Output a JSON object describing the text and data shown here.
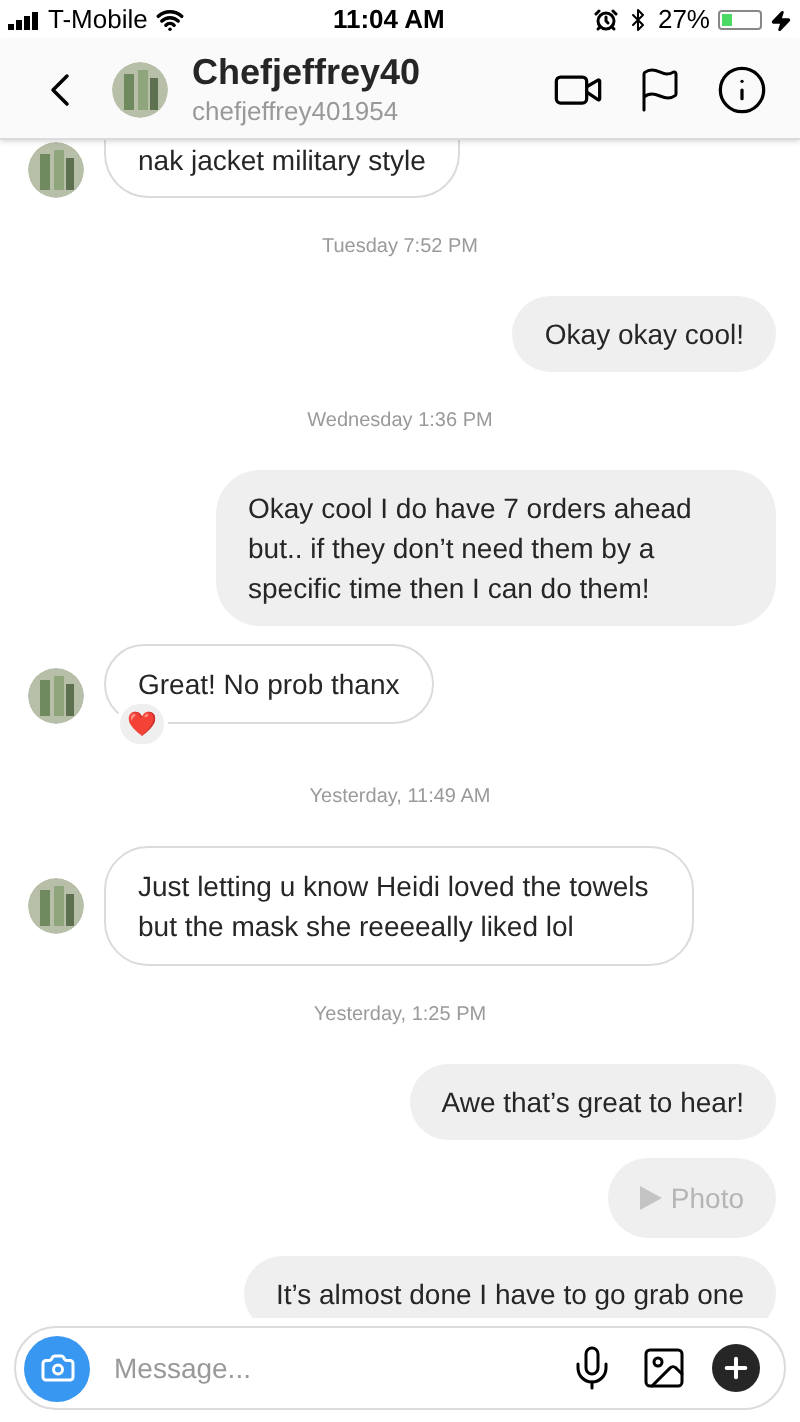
{
  "status_bar": {
    "carrier": "T-Mobile",
    "time": "11:04 AM",
    "battery": "27%"
  },
  "header": {
    "name": "Chefjeffrey40",
    "username": "chefjeffrey401954"
  },
  "messages": [
    {
      "kind": "incoming",
      "text": "nak jacket military style"
    },
    {
      "kind": "time",
      "text": "Tuesday 7:52 PM"
    },
    {
      "kind": "outgoing",
      "text": "Okay okay cool!"
    },
    {
      "kind": "time",
      "text": "Wednesday 1:36 PM"
    },
    {
      "kind": "outgoing",
      "text": "Okay cool I do have 7 orders ahead but.. if they don’t need them by a specific time then I can do them!"
    },
    {
      "kind": "incoming",
      "text": "Great! No prob thanx",
      "reaction": "❤️"
    },
    {
      "kind": "time",
      "text": "Yesterday, 11:49 AM"
    },
    {
      "kind": "incoming",
      "text": "Just letting u know Heidi loved the towels but the mask she reeeeally liked lol"
    },
    {
      "kind": "time",
      "text": "Yesterday, 1:25 PM"
    },
    {
      "kind": "outgoing",
      "text": "Awe that’s great to hear!"
    },
    {
      "kind": "photo",
      "text": "Photo"
    },
    {
      "kind": "outgoing",
      "text": "It’s almost done I have to go grab one"
    }
  ],
  "composer": {
    "placeholder": "Message..."
  }
}
